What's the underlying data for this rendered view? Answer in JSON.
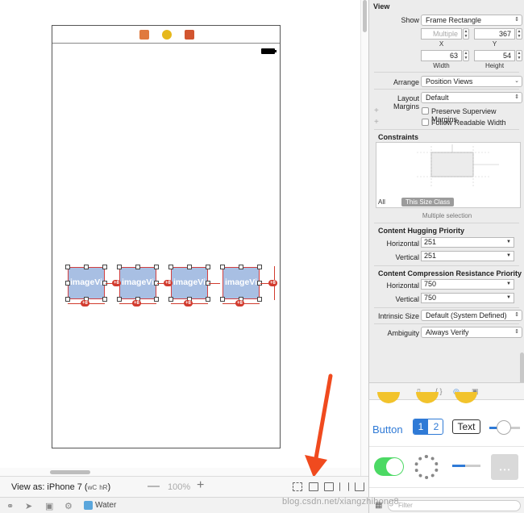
{
  "canvas": {
    "image_views": [
      {
        "label": "imageVi"
      },
      {
        "label": "imageVi"
      },
      {
        "label": "imageVi"
      },
      {
        "label": "imageVi"
      }
    ],
    "constraint_badges": [
      "+8",
      "+8",
      "+8",
      "+8"
    ]
  },
  "bottom_bar": {
    "view_as": "View as: iPhone 7",
    "size_class_w": "wC",
    "size_class_h": "hR",
    "zoom_level": "100%",
    "zoom_minus": "—",
    "zoom_plus": "+"
  },
  "status_bar": {
    "scheme": "Water",
    "watermark": "blog.csdn.net/xiangzhihong8"
  },
  "inspector": {
    "view": {
      "title": "View",
      "show_label": "Show",
      "show_value": "Frame Rectangle",
      "x_value": "Multiple",
      "y_value": "367",
      "x_label": "X",
      "y_label": "Y",
      "width_value": "63",
      "height_value": "54",
      "width_label": "Width",
      "height_label": "Height",
      "arrange_label": "Arrange",
      "arrange_value": "Position Views",
      "margins_label": "Layout Margins",
      "margins_value": "Default",
      "preserve_label": "Preserve Superview Margins",
      "readable_label": "Follow Readable Width"
    },
    "constraints": {
      "title": "Constraints",
      "tab_all": "All",
      "tab_size_class": "This Size Class",
      "note": "Multiple selection"
    },
    "hugging": {
      "title": "Content Hugging Priority",
      "horizontal_label": "Horizontal",
      "horizontal_value": "251",
      "vertical_label": "Vertical",
      "vertical_value": "251"
    },
    "compression": {
      "title": "Content Compression Resistance Priority",
      "horizontal_label": "Horizontal",
      "horizontal_value": "750",
      "vertical_label": "Vertical",
      "vertical_value": "750"
    },
    "intrinsic_label": "Intrinsic Size",
    "intrinsic_value": "Default (System Defined)",
    "ambiguity_label": "Ambiguity",
    "ambiguity_value": "Always Verify"
  },
  "library": {
    "button_label": "Button",
    "segment_1": "1",
    "segment_2": "2",
    "text_label": "Text",
    "filter_placeholder": "Filter"
  },
  "colors": {
    "accent": "#2f7ad6",
    "constraint_red": "#d23b2e",
    "imageview_fill": "#a8bfe3",
    "switch_green": "#4cd964",
    "arrow": "#f04a1e"
  }
}
